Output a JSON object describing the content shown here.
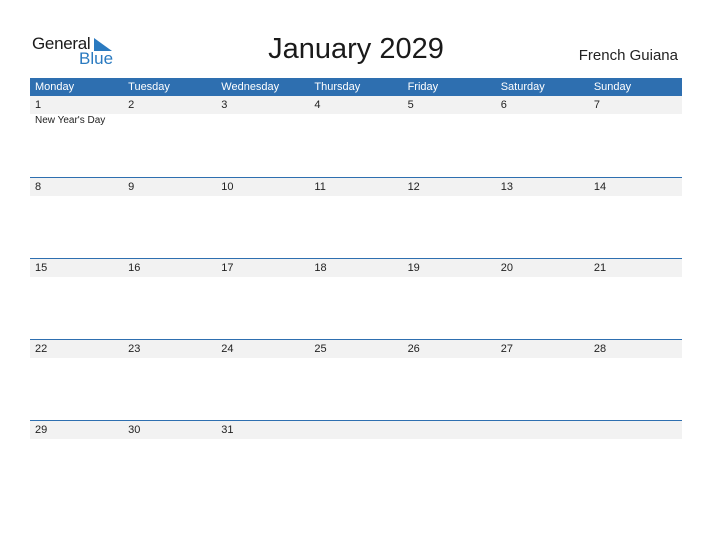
{
  "logo": {
    "word1": "General",
    "word2": "Blue",
    "icon": "blue-triangle-flag-icon"
  },
  "header": {
    "title": "January 2029",
    "country": "French Guiana"
  },
  "colors": {
    "accent": "#2e6fb0",
    "day_band": "#f2f2f2",
    "logo_blue": "#2a7ac0"
  },
  "weekdays": [
    "Monday",
    "Tuesday",
    "Wednesday",
    "Thursday",
    "Friday",
    "Saturday",
    "Sunday"
  ],
  "weeks": [
    {
      "days": [
        "1",
        "2",
        "3",
        "4",
        "5",
        "6",
        "7"
      ],
      "events": [
        "New Year's Day",
        "",
        "",
        "",
        "",
        "",
        ""
      ]
    },
    {
      "days": [
        "8",
        "9",
        "10",
        "11",
        "12",
        "13",
        "14"
      ],
      "events": [
        "",
        "",
        "",
        "",
        "",
        "",
        ""
      ]
    },
    {
      "days": [
        "15",
        "16",
        "17",
        "18",
        "19",
        "20",
        "21"
      ],
      "events": [
        "",
        "",
        "",
        "",
        "",
        "",
        ""
      ]
    },
    {
      "days": [
        "22",
        "23",
        "24",
        "25",
        "26",
        "27",
        "28"
      ],
      "events": [
        "",
        "",
        "",
        "",
        "",
        "",
        ""
      ]
    },
    {
      "days": [
        "29",
        "30",
        "31",
        "",
        "",
        "",
        ""
      ],
      "events": [
        "",
        "",
        "",
        "",
        "",
        "",
        ""
      ]
    }
  ]
}
